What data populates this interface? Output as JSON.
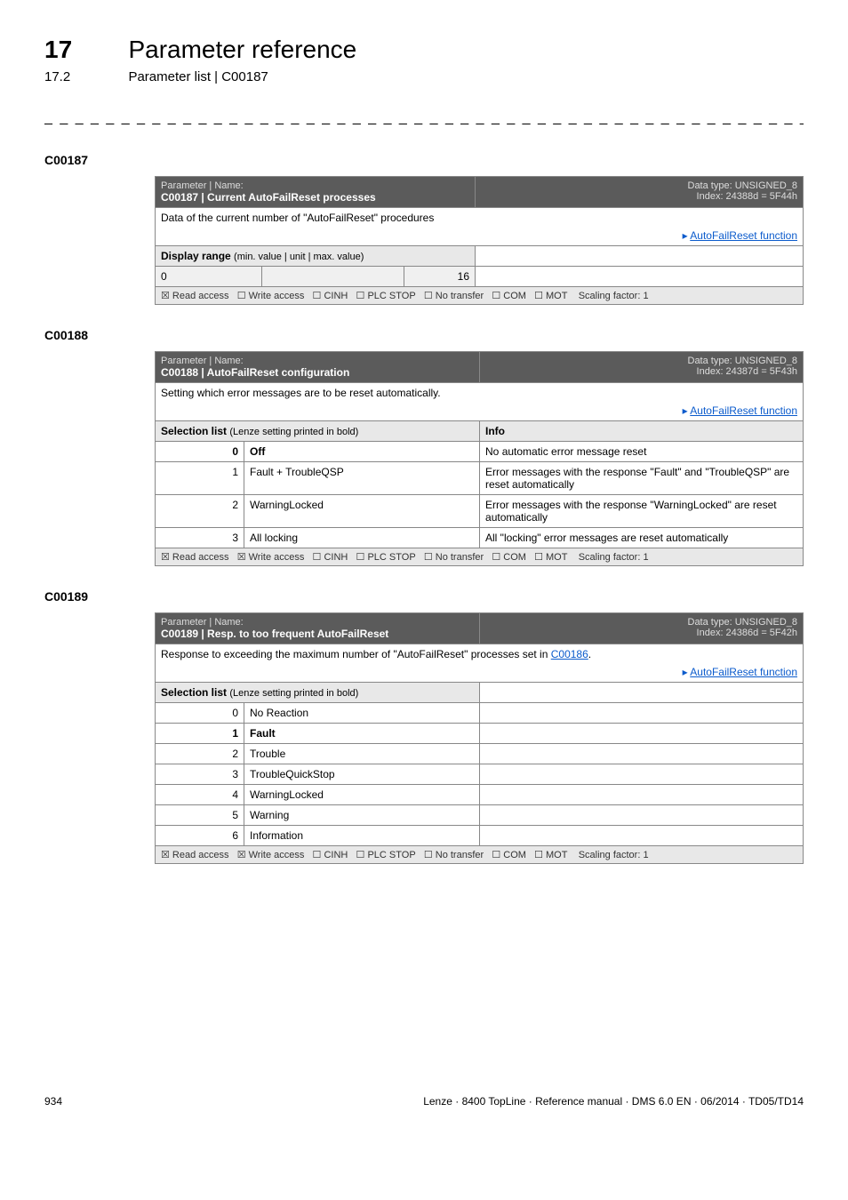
{
  "chapter": {
    "num": "17",
    "title": "Parameter reference"
  },
  "section": {
    "num": "17.2",
    "title": "Parameter list | C00187"
  },
  "dashes": "_ _ _ _ _ _ _ _ _ _ _ _ _ _ _ _ _ _ _ _ _ _ _ _ _ _ _ _ _ _ _ _ _ _ _ _ _ _ _ _ _ _ _ _ _ _ _ _ _ _ _ _ _ _ _ _ _ _ _ _ _ _ _ _",
  "common": {
    "param_name_label": "Parameter | Name:",
    "data_type_label": "Data type: UNSIGNED_8",
    "read_access": "☒ Read access",
    "write_access_off": "☐ Write access",
    "write_access_on": "☒ Write access",
    "cinh": "☐ CINH",
    "plcstop": "☐ PLC STOP",
    "notransfer": "☐ No transfer",
    "com": "☐ COM",
    "mot": "☐ MOT",
    "scaling": "Scaling factor: 1",
    "link_autofail": "AutoFailReset function",
    "arrow": "▸"
  },
  "c187": {
    "code": "C00187",
    "title": "C00187 | Current AutoFailReset processes",
    "index": "Index: 24388d = 5F44h",
    "desc": "Data of the current number of \"AutoFailReset\" procedures",
    "display_range_label": "Display range",
    "display_range_sub": "(min. value | unit | max. value)",
    "min": "0",
    "max": "16"
  },
  "c188": {
    "code": "C00188",
    "title": "C00188 | AutoFailReset configuration",
    "index": "Index: 24387d = 5F43h",
    "desc": "Setting which error messages are to be reset automatically.",
    "selection_label": "Selection list",
    "selection_sub": "(Lenze setting printed in bold)",
    "info_label": "Info",
    "rows": [
      {
        "n": "0",
        "name": "Off",
        "bold": true,
        "info": "No automatic error message reset"
      },
      {
        "n": "1",
        "name": "Fault + TroubleQSP",
        "bold": false,
        "info": "Error messages with the response \"Fault\" and \"TroubleQSP\" are reset automatically"
      },
      {
        "n": "2",
        "name": "WarningLocked",
        "bold": false,
        "info": "Error messages with the response \"WarningLocked\" are reset automatically"
      },
      {
        "n": "3",
        "name": "All locking",
        "bold": false,
        "info": "All \"locking\" error messages are reset automatically"
      }
    ]
  },
  "c189": {
    "code": "C00189",
    "title": "C00189 | Resp. to too frequent AutoFailReset",
    "index": "Index: 24386d = 5F42h",
    "desc_pre": "Response to exceeding the maximum number of \"AutoFailReset\" processes set in ",
    "desc_link": "C00186",
    "desc_post": ".",
    "selection_label": "Selection list",
    "selection_sub": "(Lenze setting printed in bold)",
    "rows": [
      {
        "n": "0",
        "name": "No Reaction",
        "bold": false
      },
      {
        "n": "1",
        "name": "Fault",
        "bold": true
      },
      {
        "n": "2",
        "name": "Trouble",
        "bold": false
      },
      {
        "n": "3",
        "name": "TroubleQuickStop",
        "bold": false
      },
      {
        "n": "4",
        "name": "WarningLocked",
        "bold": false
      },
      {
        "n": "5",
        "name": "Warning",
        "bold": false
      },
      {
        "n": "6",
        "name": "Information",
        "bold": false
      }
    ]
  },
  "footer": {
    "pagenum": "934",
    "right": "Lenze · 8400 TopLine · Reference manual · DMS 6.0 EN · 06/2014 · TD05/TD14"
  }
}
